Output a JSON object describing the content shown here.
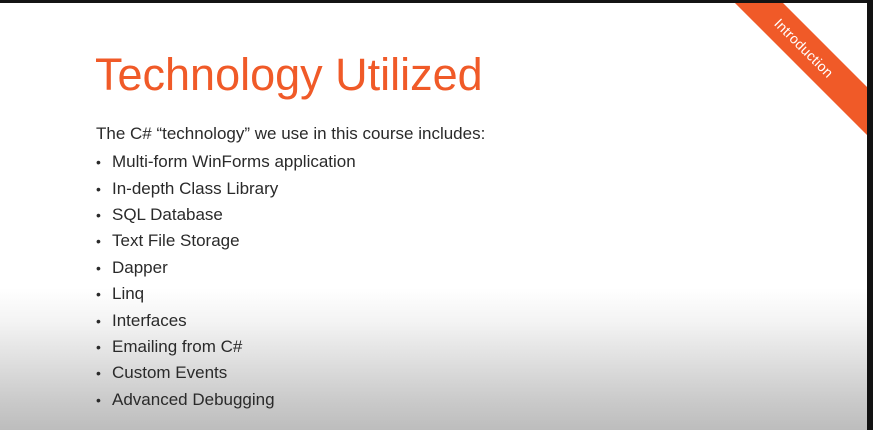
{
  "slide": {
    "title": "Technology Utilized",
    "intro": "The C# “technology” we use in this course includes:",
    "bullet_glyph": "•",
    "items": [
      "Multi-form WinForms application",
      "In-depth Class Library",
      "SQL Database",
      "Text File Storage",
      "Dapper",
      "Linq",
      "Interfaces",
      "Emailing from C#",
      "Custom Events",
      "Advanced Debugging"
    ],
    "ribbon_label": "Introduction"
  },
  "colors": {
    "accent": "#f05a28",
    "text": "#2a2a2a",
    "background": "#ffffff"
  }
}
